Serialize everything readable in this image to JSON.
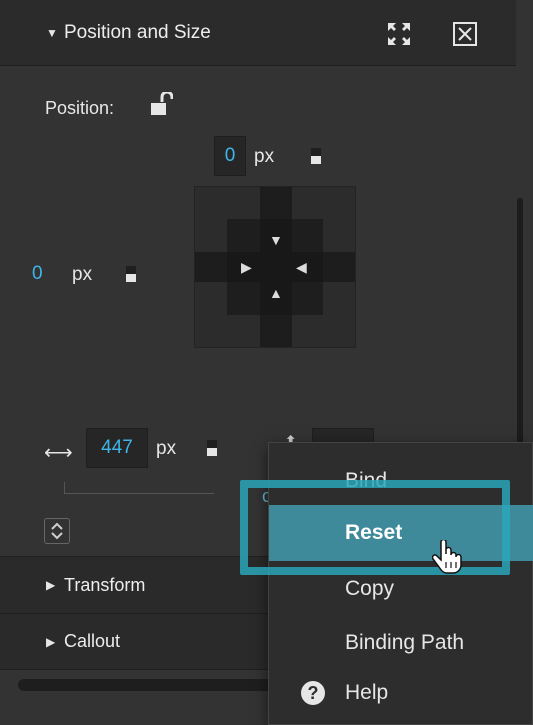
{
  "panel": {
    "position_size": {
      "title": "Position and Size",
      "collapsed": false
    },
    "position_label": "Position:",
    "top_value": "0",
    "left_value": "0",
    "unit": "px",
    "width_value": "447",
    "transform": {
      "title": "Transform"
    },
    "callout": {
      "title": "Callout"
    }
  },
  "context_menu": {
    "items": [
      {
        "label": "Bind"
      },
      {
        "label": "Reset"
      },
      {
        "label": "Copy"
      },
      {
        "label": "Binding Path"
      },
      {
        "label": "Help"
      }
    ]
  },
  "icons": {
    "collapse": "triangle-down-icon",
    "expand": "triangle-right-icon",
    "fit": "expand-arrows-icon",
    "close": "close-box-icon",
    "lock": "unlocked-padlock-icon",
    "help": "question-circle-icon",
    "cursor": "hand-pointer-icon"
  },
  "colors": {
    "accent": "#3fb6e9",
    "highlight": "#3f8a9a",
    "focus_ring": "#2aa6b8"
  }
}
